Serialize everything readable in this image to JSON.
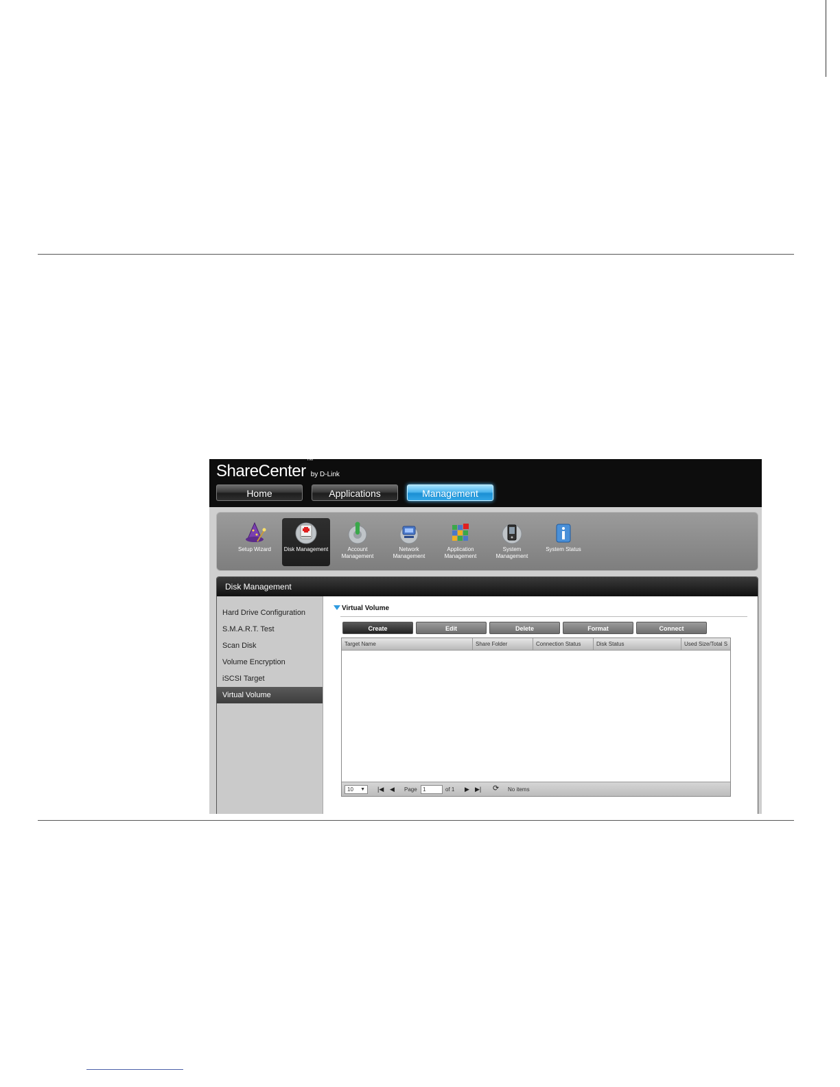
{
  "app": {
    "brand": "ShareCenter",
    "trademark": "TM",
    "brand_sub": "by D-Link"
  },
  "nav_tabs": [
    {
      "label": "Home"
    },
    {
      "label": "Applications"
    },
    {
      "label": "Management",
      "active": true
    }
  ],
  "icon_bar": [
    {
      "label": "Setup Wizard",
      "icon": "wizard-icon"
    },
    {
      "label": "Disk Management",
      "icon": "disk-management-icon",
      "active": true
    },
    {
      "label": "Account Management",
      "icon": "account-management-icon"
    },
    {
      "label": "Network Management",
      "icon": "network-management-icon"
    },
    {
      "label": "Application Management",
      "icon": "application-management-icon"
    },
    {
      "label": "System Management",
      "icon": "system-management-icon"
    },
    {
      "label": "System Status",
      "icon": "info-icon"
    }
  ],
  "panel": {
    "title": "Disk Management"
  },
  "sidebar": {
    "items": [
      {
        "label": "Hard Drive Configuration"
      },
      {
        "label": "S.M.A.R.T. Test"
      },
      {
        "label": "Scan Disk"
      },
      {
        "label": "Volume Encryption"
      },
      {
        "label": "iSCSI Target"
      },
      {
        "label": "Virtual Volume",
        "active": true
      }
    ]
  },
  "section": {
    "title": "Virtual Volume"
  },
  "toolbar": {
    "buttons": [
      {
        "label": "Create",
        "active": true
      },
      {
        "label": "Edit"
      },
      {
        "label": "Delete"
      },
      {
        "label": "Format"
      },
      {
        "label": "Connect"
      }
    ]
  },
  "table": {
    "columns": [
      "Target Name",
      "Share Folder",
      "Connection Status",
      "Disk Status",
      "Used Size/Total S"
    ],
    "rows": []
  },
  "pager": {
    "page_size": "10",
    "page_label": "Page",
    "page_value": "1",
    "of_label": "of 1",
    "status": "No items"
  },
  "colors": {
    "active_tab": "#1b8fd3",
    "topbar": "#0d0d0d",
    "section_arrow": "#2f9be0"
  }
}
